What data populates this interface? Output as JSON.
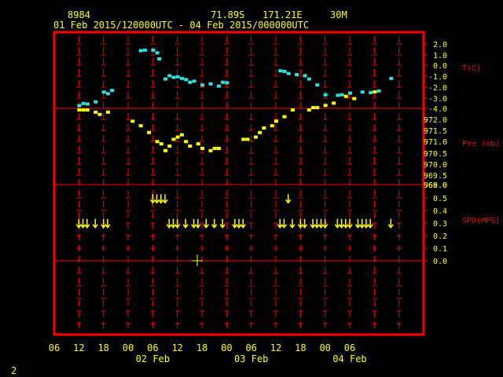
{
  "header": {
    "station_id": "8984",
    "latitude": "71.89S",
    "longitude": "171.21E",
    "elevation": "30M",
    "date_range": "01 Feb 2015/120000UTC - 04 Feb 2015/000000UTC"
  },
  "footer": {
    "page_number": "2"
  },
  "colors": {
    "frame": "#ff0000",
    "grid": "#ff0000",
    "axis_text": "#ffff00",
    "label_text": "#ff0000",
    "temperature": "#33e0e0",
    "pressure": "#ffff00",
    "wind": "#ffff00"
  },
  "chart_data": [
    {
      "type": "scatter",
      "panel": "temperature",
      "ylabel": "T(C)",
      "ylim": [
        -4.0,
        2.5
      ],
      "yticks": [
        "2.0",
        "1.0",
        "0.0",
        "-1.0",
        "-2.0",
        "-3.0",
        "-4.0"
      ],
      "x_hours_from_feb1_00utc": [
        12,
        13,
        14,
        16,
        18,
        19,
        20,
        27,
        28,
        30,
        31,
        31.5,
        33,
        34,
        35,
        36,
        37,
        38,
        39,
        40,
        42,
        44,
        46,
        47,
        48,
        61,
        62,
        63,
        65,
        67,
        68,
        70,
        72,
        75,
        76,
        78,
        81,
        83,
        85,
        88
      ],
      "y": [
        -3.75,
        -3.55,
        -3.6,
        -3.4,
        -2.5,
        -2.65,
        -2.35,
        1.3,
        1.35,
        1.35,
        1.1,
        0.55,
        -1.3,
        -1.0,
        -1.15,
        -1.1,
        -1.25,
        -1.35,
        -1.6,
        -1.5,
        -1.85,
        -1.75,
        -1.95,
        -1.6,
        -1.65,
        -0.55,
        -0.6,
        -0.8,
        -0.9,
        -1.0,
        -1.3,
        -1.85,
        -2.75,
        -2.8,
        -2.75,
        -2.6,
        -2.5,
        -2.55,
        -2.4,
        -1.25
      ]
    },
    {
      "type": "scatter",
      "panel": "pressure",
      "ylabel": "Pre (mb)",
      "ylim": [
        968.0,
        972.5
      ],
      "yticks": [
        "972.0",
        "971.5",
        "971.0",
        "970.5",
        "970.0",
        "969.5",
        "969.0",
        "968.0"
      ],
      "x_hours_from_feb1_00utc": [
        12,
        13,
        14,
        16,
        17,
        19,
        25,
        27,
        29,
        31,
        32,
        33,
        34,
        35,
        36,
        37,
        38,
        39,
        41,
        42,
        44,
        45,
        46,
        52,
        53,
        55,
        56,
        57,
        59,
        60,
        62,
        64,
        68,
        69,
        70,
        72,
        74,
        77,
        79,
        84
      ],
      "y": [
        971.3,
        971.3,
        971.3,
        971.2,
        971.1,
        971.2,
        970.8,
        970.6,
        970.3,
        969.9,
        969.8,
        969.5,
        969.7,
        970.0,
        970.1,
        970.2,
        969.9,
        969.7,
        969.8,
        969.6,
        969.5,
        969.6,
        969.6,
        970.0,
        970.0,
        970.1,
        970.3,
        970.5,
        970.6,
        970.8,
        971.0,
        971.3,
        971.3,
        971.4,
        971.4,
        971.5,
        971.6,
        971.9,
        971.8,
        972.1
      ]
    },
    {
      "type": "scatter",
      "panel": "wind",
      "marker": "down-arrow",
      "ylabel": "SPD(MPS)",
      "ylim": [
        -0.05,
        0.55
      ],
      "yticks": [
        "0.5",
        "0.4",
        "0.3",
        "0.2",
        "0.1",
        "0.0"
      ],
      "x_hours_from_feb1_00utc": [
        12,
        13,
        14,
        16,
        18,
        19,
        30,
        31,
        32,
        33,
        34,
        35,
        36,
        38,
        40,
        41,
        43,
        45,
        47,
        50,
        51,
        52,
        61,
        62,
        63,
        64,
        66,
        67,
        69,
        70,
        71,
        72,
        75,
        76,
        77,
        78,
        80,
        81,
        82,
        83,
        88
      ],
      "y": [
        0.3,
        0.3,
        0.3,
        0.3,
        0.3,
        0.3,
        0.5,
        0.5,
        0.5,
        0.5,
        0.3,
        0.3,
        0.3,
        0.3,
        0.3,
        0.3,
        0.3,
        0.3,
        0.3,
        0.3,
        0.3,
        0.3,
        0.3,
        0.3,
        0.5,
        0.3,
        0.3,
        0.3,
        0.3,
        0.3,
        0.3,
        0.3,
        0.3,
        0.3,
        0.3,
        0.3,
        0.3,
        0.3,
        0.3,
        0.3,
        0.3
      ]
    }
  ],
  "x_axis": {
    "range_hours": [
      6,
      96
    ],
    "tick_labels": [
      "06",
      "12",
      "18",
      "00",
      "06",
      "12",
      "18",
      "00",
      "06",
      "12",
      "18",
      "00",
      "06"
    ],
    "day_labels": [
      "02 Feb",
      "03 Feb",
      "04 Feb"
    ]
  }
}
